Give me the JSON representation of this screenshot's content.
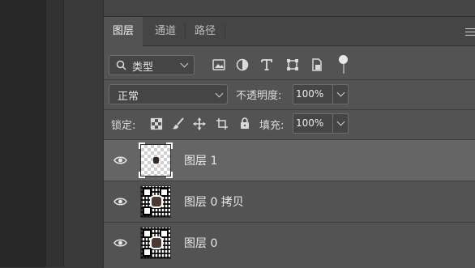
{
  "panel": {
    "tabs": [
      {
        "label": "图层",
        "active": true
      },
      {
        "label": "通道",
        "active": false
      },
      {
        "label": "路径",
        "active": false
      }
    ],
    "menu_icon": "panel-menu-icon"
  },
  "filter": {
    "kind_label": "类型",
    "icons": [
      "image-filter-icon",
      "adjustment-filter-icon",
      "type-filter-icon",
      "shape-filter-icon",
      "smart-object-filter-icon"
    ]
  },
  "blend": {
    "mode": "正常",
    "opacity_label": "不透明度:",
    "opacity_value": "100%"
  },
  "lock": {
    "label": "锁定:",
    "fill_label": "填充:",
    "fill_value": "100%",
    "icons": [
      "lock-transparent-pixels-icon",
      "lock-image-pixels-icon",
      "lock-position-icon",
      "lock-artboard-icon",
      "lock-all-icon"
    ]
  },
  "layers": [
    {
      "name": "图层 1",
      "selected": true,
      "visible": true,
      "thumbnail": "transparent-with-small-object"
    },
    {
      "name": "图层 0 拷贝",
      "selected": false,
      "visible": true,
      "thumbnail": "qr-code"
    },
    {
      "name": "图层 0",
      "selected": false,
      "visible": true,
      "thumbnail": "qr-code"
    }
  ],
  "colors": {
    "panel_bg": "#535353",
    "selected_layer_bg": "#656565",
    "tab_bar_bg": "#454545"
  }
}
